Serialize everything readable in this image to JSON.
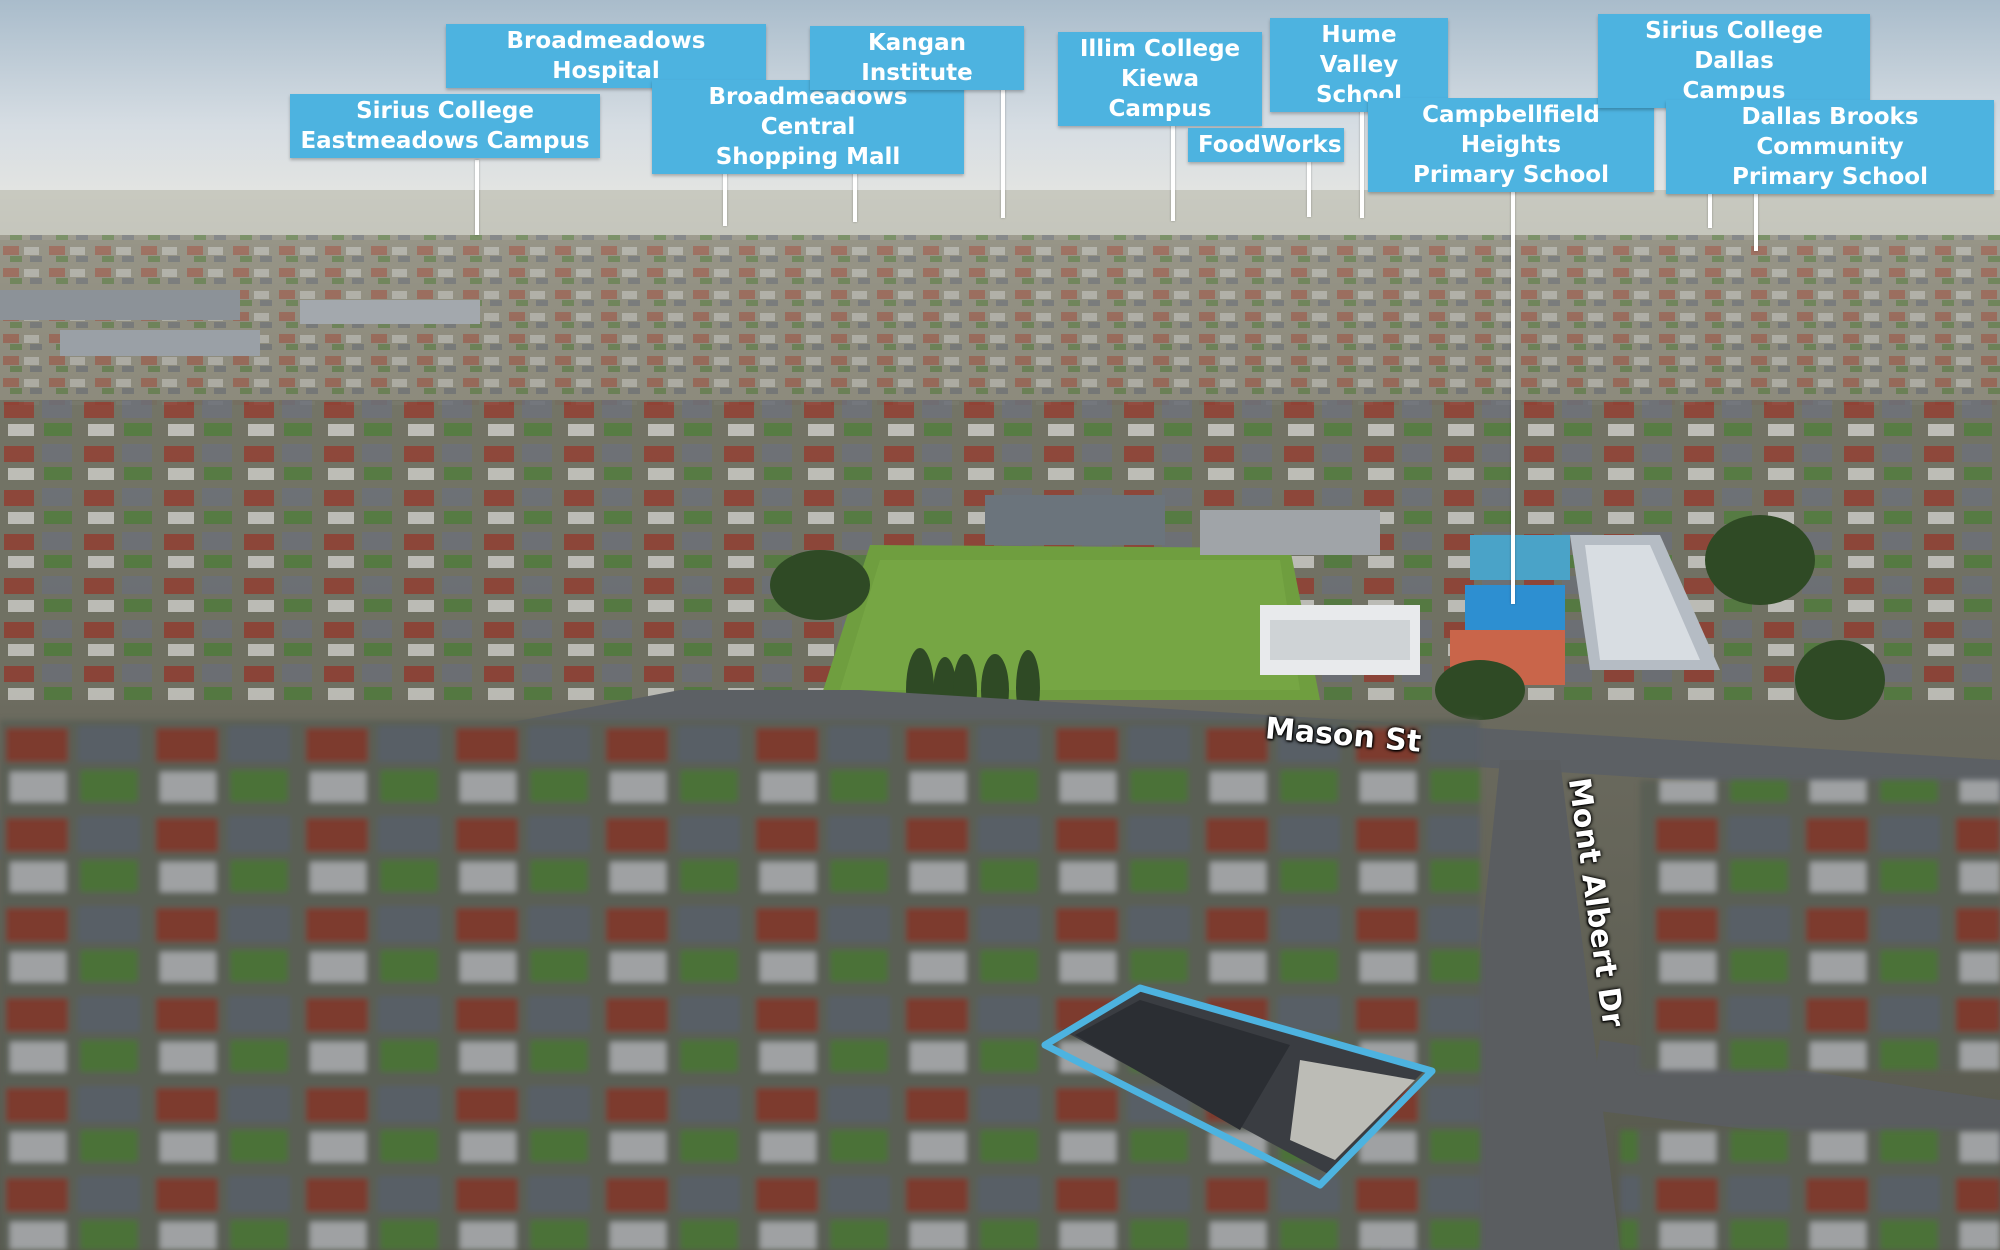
{
  "photo": {
    "description_icon": "aerial-photo",
    "colors": {
      "sky": "#c9d3dc",
      "haze": "#dfe2e4",
      "roof_red": "#8f3d30",
      "roof_grey": "#5b6068",
      "grass": "#5f8f3e",
      "oval_green": "#6f9e3f",
      "court_blue": "#2d8fd1",
      "road": "#5a5d60",
      "highlight": "#4db3e0"
    }
  },
  "labels": {
    "sirius_eastmeadows": "Sirius College\nEastmeadows Campus",
    "broadmeadows_hospital": "Broadmeadows Hospital",
    "broadmeadows_central": "Broadmeadows Central\nShopping Mall",
    "kangan_institute": "Kangan Institute",
    "illim_college": "Illim College\nKiewa Campus",
    "foodworks": "FoodWorks",
    "hume_valley": "Hume Valley\nSchool",
    "campbellfield_heights": "Campbellfield Heights\nPrimary School",
    "sirius_dallas": "Sirius College Dallas\nCampus",
    "dallas_brooks": "Dallas Brooks Community\nPrimary School"
  },
  "streets": {
    "mason_st": "Mason St",
    "mont_albert_dr": "Mont Albert Dr"
  }
}
